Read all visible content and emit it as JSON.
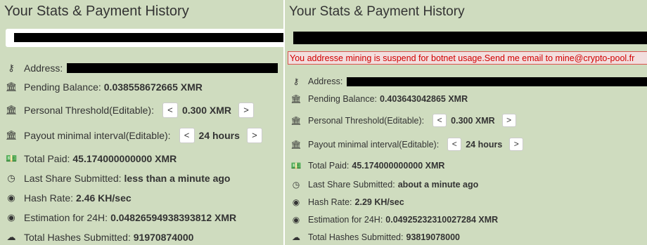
{
  "left": {
    "title": "Your Stats & Payment History",
    "address_label": "Address:",
    "pending_label": "Pending Balance:",
    "pending_value": "0.038558672665 XMR",
    "threshold_label": "Personal Threshold(Editable):",
    "threshold_value": "0.300 XMR",
    "interval_label": "Payout minimal interval(Editable):",
    "interval_value": "24 hours",
    "total_paid_label": "Total Paid:",
    "total_paid_value": "45.174000000000 XMR",
    "last_share_label": "Last Share Submitted:",
    "last_share_value": "less than a minute ago",
    "hash_rate_label": "Hash Rate:",
    "hash_rate_value": "2.46 KH/sec",
    "estimation_label": "Estimation for 24H:",
    "estimation_value": "0.04826594938393812 XMR",
    "total_hashes_label": "Total Hashes Submitted:",
    "total_hashes_value": "91970874000",
    "decrease_label": "<",
    "increase_label": ">"
  },
  "right": {
    "title": "Your Stats & Payment History",
    "notice": "You addresse mining is suspend for botnet usage.Send me email to mine@crypto-pool.fr",
    "address_label": "Address:",
    "pending_label": "Pending Balance:",
    "pending_value": "0.403643042865 XMR",
    "threshold_label": "Personal Threshold(Editable):",
    "threshold_value": "0.300 XMR",
    "interval_label": "Payout minimal interval(Editable):",
    "interval_value": "24 hours",
    "total_paid_label": "Total Paid:",
    "total_paid_value": "45.174000000000 XMR",
    "last_share_label": "Last Share Submitted:",
    "last_share_value": "about a minute ago",
    "hash_rate_label": "Hash Rate:",
    "hash_rate_value": "2.29 KH/sec",
    "estimation_label": "Estimation for 24H:",
    "estimation_value": "0.04925232310027284 XMR",
    "total_hashes_label": "Total Hashes Submitted:",
    "total_hashes_value": "93819078000",
    "decrease_label": "<",
    "increase_label": ">"
  },
  "icons": {
    "address": "key-icon",
    "pending": "bank-icon",
    "threshold": "bank-icon",
    "interval": "bank-icon",
    "total_paid": "money-icon",
    "last_share": "clock-icon",
    "hash_rate": "dashboard-icon",
    "estimation": "dashboard-icon",
    "total_hashes": "cloud-upload-icon"
  },
  "colors": {
    "panel_bg": "#cfdcbf",
    "notice_text": "#d10000",
    "notice_border": "#d9534f"
  }
}
